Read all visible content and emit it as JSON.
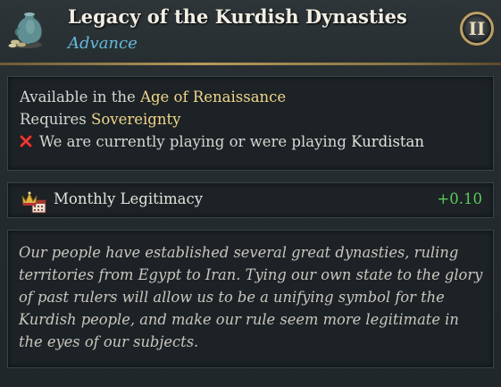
{
  "header": {
    "title": "Legacy of the Kurdish Dynasties",
    "subtitle": "Advance",
    "level": "II",
    "item_icon": "vase-and-coins-icon",
    "level_icon": "roman-numeral-badge-icon"
  },
  "requirements": {
    "line1_prefix": "Available in the ",
    "line1_value": "Age of Renaissance",
    "line2_prefix": "Requires ",
    "line2_value": "Sovereignty",
    "line3_prefix": "We are currently playing or were playing ",
    "line3_value": "Kurdistan",
    "line3_icon": "red-cross-icon"
  },
  "modifier": {
    "icon": "crown-calendar-icon",
    "label": "Monthly Legitimacy",
    "value": "+0.10"
  },
  "description": {
    "lines": [
      "Our people have established several great dynasties, ruling",
      "territories from Egypt to Iran. Tying our own state to the glory",
      "of past rulers will allow us to be a unifying symbol for the",
      "Kurdish people, and make our rule seem more legitimate in",
      "the eyes of our subjects."
    ]
  },
  "colors": {
    "title": "#f3eee4",
    "subtitle": "#67b9dc",
    "highlight": "#f1d68a",
    "positive": "#5ccb5c",
    "accent_gold": "#b59a5c"
  }
}
